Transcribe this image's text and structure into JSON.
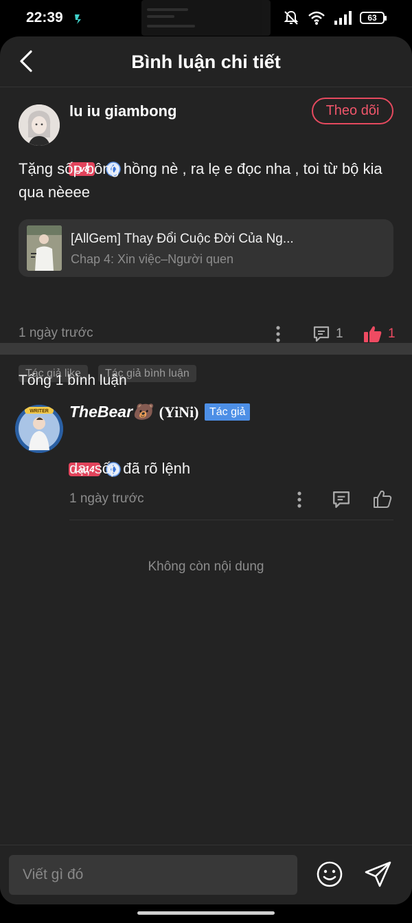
{
  "status_bar": {
    "time": "22:39",
    "battery": "63"
  },
  "header": {
    "title": "Bình luận chi tiết"
  },
  "comment": {
    "username": "lu iu giambong",
    "level": "Lv8",
    "follow_label": "Theo dõi",
    "text": "Tặng sốp bông hồng nè , ra lẹ e đọc nha , toi từ bộ kia qua nèeee",
    "chapter_card": {
      "title": "[AllGem] Thay Đổi Cuộc Đời Của Ng...",
      "subtitle": "Chap 4: Xin việc–Người quen"
    },
    "time": "1 ngày trước",
    "reply_count": "1",
    "like_count": "1",
    "tags": [
      "Tác giả like",
      "Tác giả bình luận"
    ]
  },
  "replies_section": {
    "total_label": "Tổng 1 bình luận",
    "end_label": "Không còn nội dung"
  },
  "reply": {
    "username": "TheBear🐻",
    "username_suffix": "(YiNi)",
    "author_badge": "Tác giả",
    "level": "Lv14",
    "text": "dạ, sốp đã rõ lệnh",
    "time": "1 ngày trước"
  },
  "composer": {
    "placeholder": "Viết gì đó"
  },
  "colors": {
    "accent": "#e64a5f",
    "author_badge": "#4d8fe6",
    "background": "#232323"
  }
}
